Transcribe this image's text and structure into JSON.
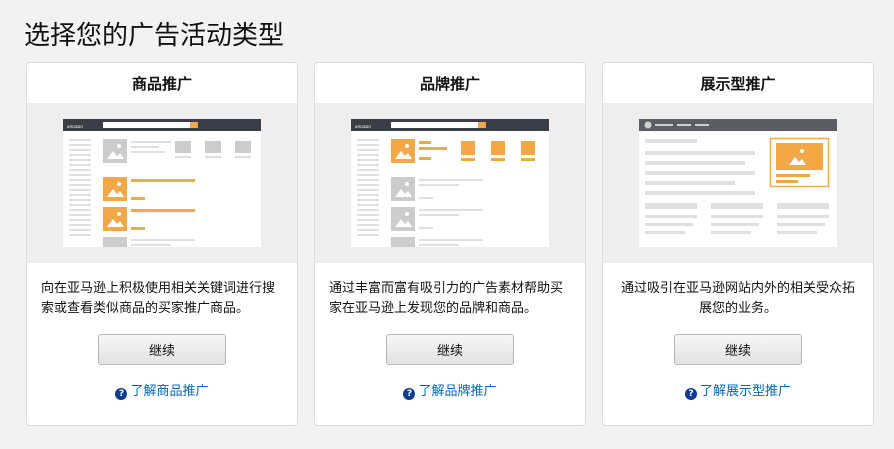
{
  "page": {
    "title": "选择您的广告活动类型"
  },
  "cards": [
    {
      "title": "商品推广",
      "mock_logo": "amazon",
      "description": "向在亚马逊上积极使用相关关键词进行搜索或查看类似商品的买家推广商品。",
      "button": "继续",
      "link": "了解商品推广"
    },
    {
      "title": "品牌推广",
      "mock_logo": "amazon",
      "description": "通过丰富而富有吸引力的广告素材帮助买家在亚马逊上发现您的品牌和商品。",
      "button": "继续",
      "link": "了解品牌推广"
    },
    {
      "title": "展示型推广",
      "description": "通过吸引在亚马逊网站内外的相关受众拓展您的业务。",
      "button": "继续",
      "link": "了解展示型推广"
    }
  ],
  "icons": {
    "help": "question-circle-icon",
    "image": "image-placeholder-icon"
  },
  "colors": {
    "accent": "#f3a847",
    "link": "#0066c0",
    "dark_bar": "#3a3f47"
  }
}
